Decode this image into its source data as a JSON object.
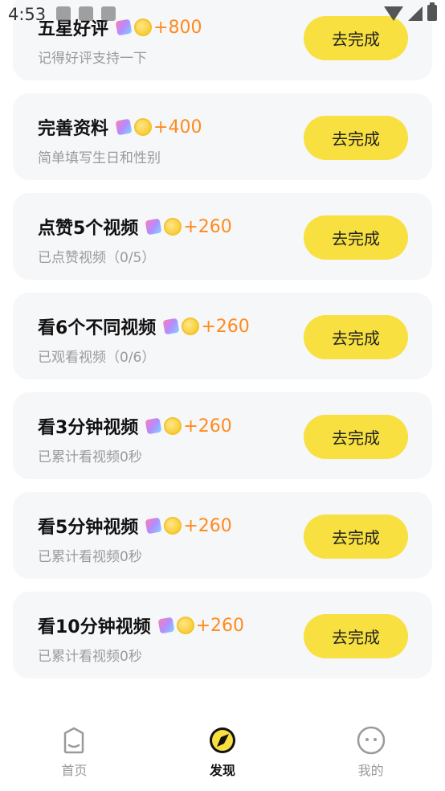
{
  "status_bar": {
    "time": "4:53"
  },
  "tasks": [
    {
      "title": "五星好评",
      "reward": "+800",
      "desc": "记得好评支持一下",
      "button": "去完成"
    },
    {
      "title": "完善资料",
      "reward": "+400",
      "desc": "简单填写生日和性别",
      "button": "去完成"
    },
    {
      "title": "点赞5个视频",
      "reward": "+260",
      "desc": "已点赞视频（0/5）",
      "button": "去完成"
    },
    {
      "title": "看6个不同视频",
      "reward": "+260",
      "desc": "已观看视频（0/6）",
      "button": "去完成"
    },
    {
      "title": "看3分钟视频",
      "reward": "+260",
      "desc": "已累计看视频0秒",
      "button": "去完成"
    },
    {
      "title": "看5分钟视频",
      "reward": "+260",
      "desc": "已累计看视频0秒",
      "button": "去完成"
    },
    {
      "title": "看10分钟视频",
      "reward": "+260",
      "desc": "已累计看视频0秒",
      "button": "去完成"
    }
  ],
  "nav": {
    "items": [
      {
        "label": "首页",
        "icon": "home-icon",
        "active": false
      },
      {
        "label": "发现",
        "icon": "compass-icon",
        "active": true
      },
      {
        "label": "我的",
        "icon": "profile-face-icon",
        "active": false
      }
    ]
  },
  "colors": {
    "accent": "#f7e03f",
    "reward": "#ff8a1e",
    "card_bg": "#f6f7f9"
  }
}
